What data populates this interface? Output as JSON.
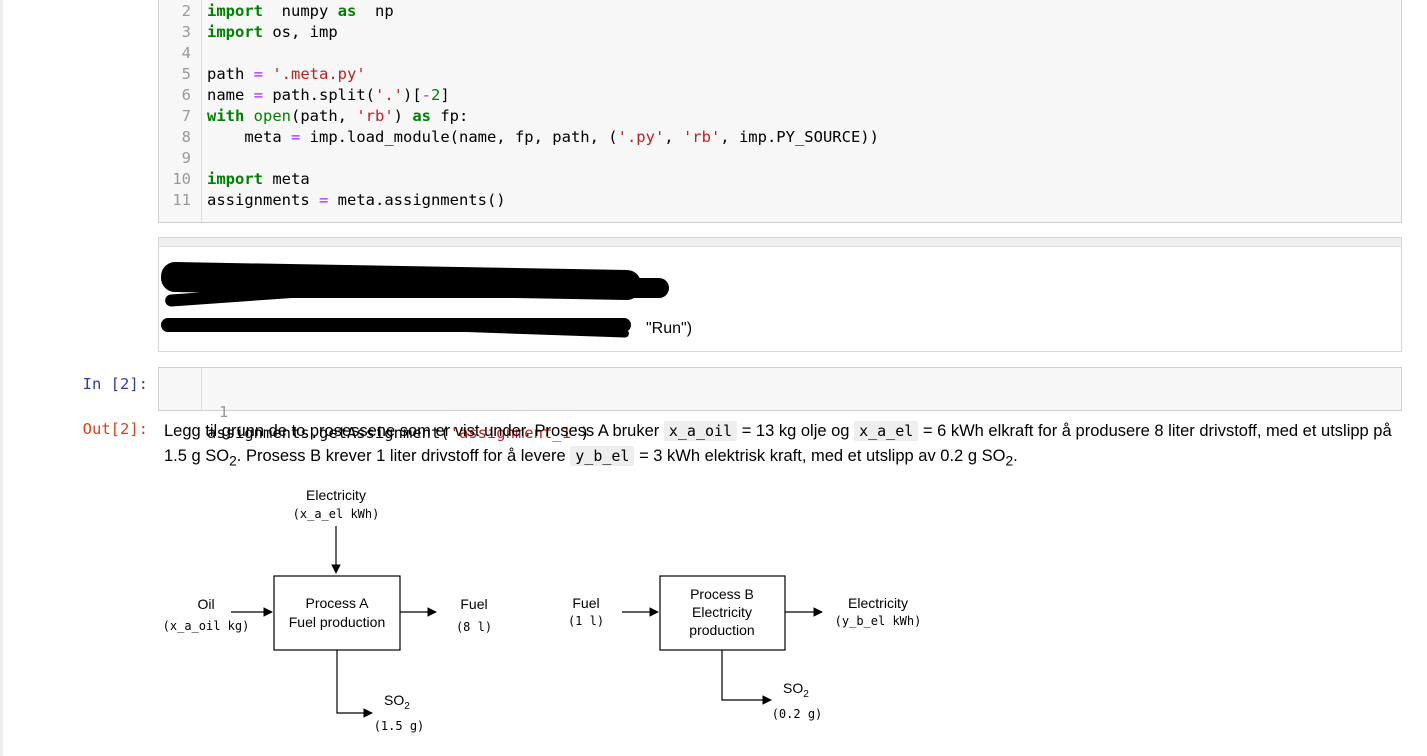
{
  "cell1": {
    "lines": [
      {
        "n": "2",
        "parts": [
          [
            "kw",
            "import"
          ],
          [
            "",
            "  numpy "
          ],
          [
            "kw",
            "as"
          ],
          [
            "",
            "  np"
          ]
        ]
      },
      {
        "n": "3",
        "parts": [
          [
            "kw",
            "import"
          ],
          [
            "",
            " os, imp"
          ]
        ]
      },
      {
        "n": "4",
        "parts": []
      },
      {
        "n": "5",
        "parts": [
          [
            "",
            "path "
          ],
          [
            "op",
            "="
          ],
          [
            "str",
            " '.meta.py'"
          ]
        ]
      },
      {
        "n": "6",
        "parts": [
          [
            "",
            "name "
          ],
          [
            "op",
            "="
          ],
          [
            "",
            " path.split("
          ],
          [
            "str",
            "'.'"
          ],
          [
            "",
            ")["
          ],
          [
            "op",
            "-"
          ],
          [
            "num",
            "2"
          ],
          [
            "",
            "]"
          ]
        ]
      },
      {
        "n": "7",
        "parts": [
          [
            "kw",
            "with"
          ],
          [
            "bi",
            " open"
          ],
          [
            "",
            "(path, "
          ],
          [
            "str",
            "'rb'"
          ],
          [
            "",
            ") "
          ],
          [
            "kw",
            "as"
          ],
          [
            "",
            " fp:"
          ]
        ]
      },
      {
        "n": "8",
        "parts": [
          [
            "",
            "    meta "
          ],
          [
            "op",
            "="
          ],
          [
            "",
            " imp.load_module(name, fp, path, ("
          ],
          [
            "str",
            "'.py'"
          ],
          [
            "",
            ", "
          ],
          [
            "str",
            "'rb'"
          ],
          [
            "",
            ", imp.PY_SOURCE))"
          ]
        ]
      },
      {
        "n": "9",
        "parts": []
      },
      {
        "n": "10",
        "parts": [
          [
            "kw",
            "import"
          ],
          [
            "",
            " meta"
          ]
        ]
      },
      {
        "n": "11",
        "parts": [
          [
            "",
            "assignments "
          ],
          [
            "op",
            "="
          ],
          [
            "",
            " meta.assignments()"
          ]
        ]
      }
    ]
  },
  "md_cell": {
    "visible_tail": "\"Run\")"
  },
  "cell2": {
    "prompt": "In [2]:",
    "line_number": "1",
    "code_prefix": "assignments.getAssignment(",
    "code_string": "'assignment_1'",
    "code_suffix": ")"
  },
  "output": {
    "prompt": "Out[2]:",
    "text1": "Legg til grunn de to prosessene som er vist under. Prosess A bruker",
    "var1": "x_a_oil",
    "text2": "= 13 kg olje og",
    "var2": "x_a_el",
    "text3": "= 6 kWh elkraft for å produsere 8 liter drivstoff, med et utslipp på 1.5 g SO",
    "text4": ". Prosess B krever 1 liter drivstoff for å levere",
    "var3": "y_b_el",
    "text5": "= 3 kWh elektrisk kraft, med et utslipp av 0.2 g SO",
    "text6": ".",
    "sub2": "2"
  },
  "diagram": {
    "a_elec_label": "Electricity",
    "a_elec_unit": "(x_a_el kWh)",
    "oil_label": "Oil",
    "oil_unit": "(x_a_oil kg)",
    "procA_line1": "Process A",
    "procA_line2": "Fuel production",
    "a_fuel_label": "Fuel",
    "a_fuel_unit": "(8 l)",
    "a_so2_label": "SO",
    "a_so2_sub": "2",
    "a_so2_unit": "(1.5 g)",
    "b_fuel_label": "Fuel",
    "b_fuel_unit": "(1 l)",
    "procB_line1": "Process B",
    "procB_line2": "Electricity",
    "procB_line3": "production",
    "b_elec_label": "Electricity",
    "b_elec_unit": "(y_b_el kWh)",
    "b_so2_label": "SO",
    "b_so2_sub": "2",
    "b_so2_unit": "(0.2 g)"
  }
}
